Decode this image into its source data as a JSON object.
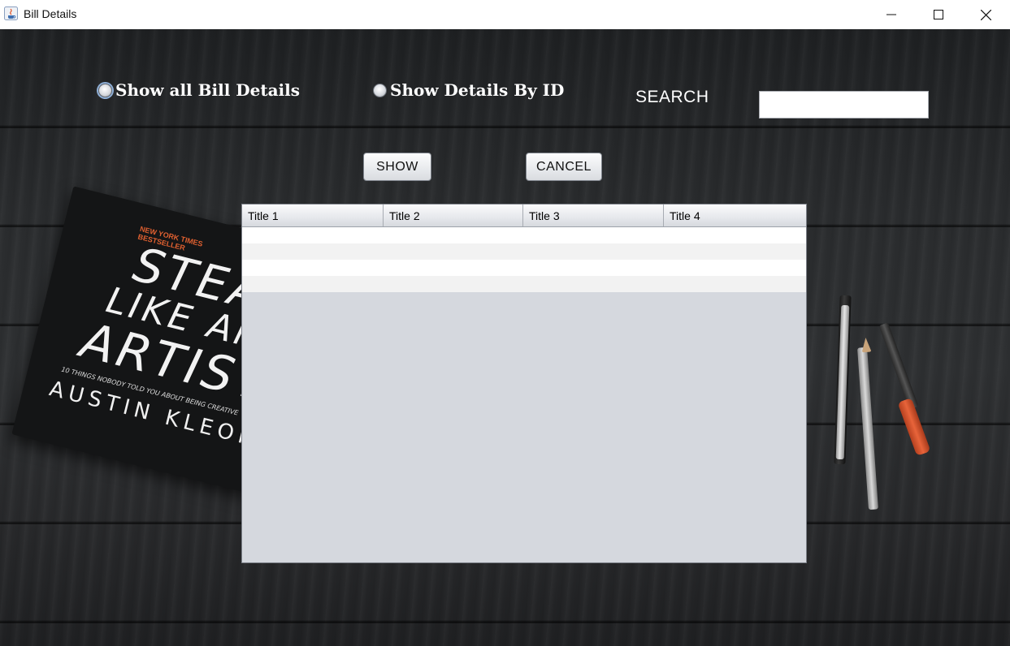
{
  "window": {
    "title": "Bill Details",
    "icons": [
      "java-app-icon",
      "minimize-icon",
      "maximize-icon",
      "close-icon"
    ]
  },
  "options": {
    "show_all_label": "Show all Bill Details",
    "show_by_id_label": "Show Details By ID",
    "selected": "show_all"
  },
  "search": {
    "label": "SEARCH",
    "value": ""
  },
  "buttons": {
    "show_label": "SHOW",
    "cancel_label": "CANCEL"
  },
  "table": {
    "columns": [
      "Title 1",
      "Title 2",
      "Title 3",
      "Title 4"
    ],
    "rows": [
      [
        "",
        "",
        "",
        ""
      ],
      [
        "",
        "",
        "",
        ""
      ],
      [
        "",
        "",
        "",
        ""
      ],
      [
        "",
        "",
        "",
        ""
      ]
    ]
  },
  "background_book": {
    "tag_line1": "NEW YORK TIMES",
    "tag_line2": "BESTSELLER",
    "word1": "STEAL",
    "word2": "LIKE AN",
    "word3": "ARTIST",
    "subtitle": "10 THINGS NOBODY TOLD YOU ABOUT BEING CREATIVE",
    "author": "AUSTIN KLEON"
  },
  "colors": {
    "accent_radio": "#8fb0d8",
    "table_empty_area": "#d5d8de",
    "label_text": "#ffffff"
  }
}
